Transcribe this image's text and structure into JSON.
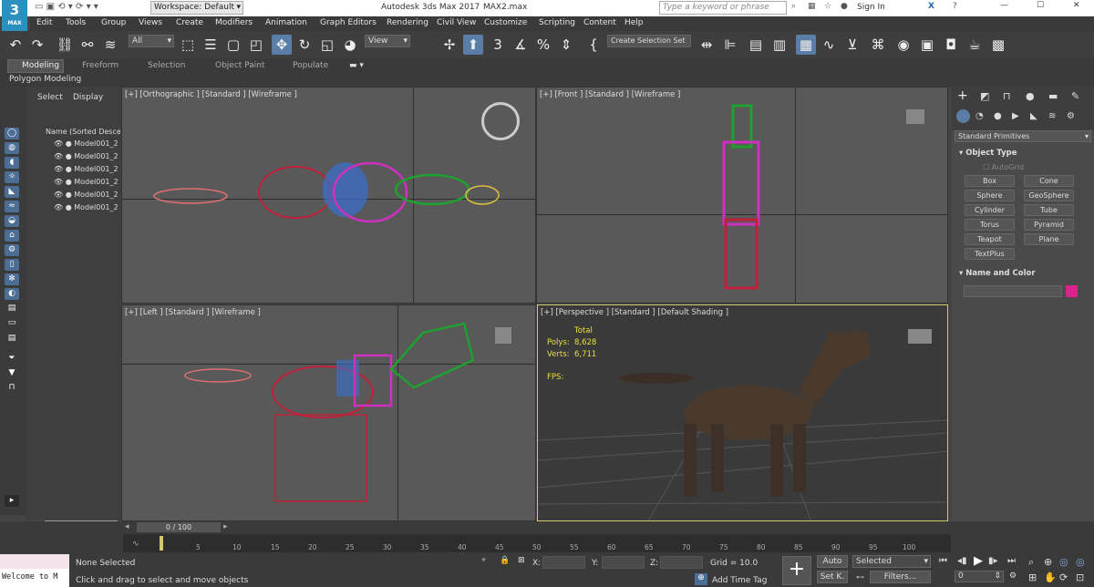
{
  "titlebar": {
    "workspace": "Workspace: Default",
    "app_title": "Autodesk 3ds Max 2017",
    "file": "MAX2.max",
    "search_placeholder": "Type a keyword or phrase",
    "sign_in": "Sign In",
    "logo_text": "3",
    "logo_sub": "MAX"
  },
  "menu": [
    "Edit",
    "Tools",
    "Group",
    "Views",
    "Create",
    "Modifiers",
    "Animation",
    "Graph Editors",
    "Rendering",
    "Civil View",
    "Customize",
    "Scripting",
    "Content",
    "Help"
  ],
  "toolbar": {
    "filter": "All",
    "ref_coord": "View",
    "selection_set": "Create Selection Set"
  },
  "ribbon": {
    "tabs": [
      "Modeling",
      "Freeform",
      "Selection",
      "Object Paint",
      "Populate"
    ],
    "sub": "Polygon Modeling"
  },
  "scene": {
    "tabs": [
      "Select",
      "Display"
    ],
    "header": "Name (Sorted Descen",
    "items": [
      "Model001_2",
      "Model001_2",
      "Model001_2",
      "Model001_2",
      "Model001_2",
      "Model001_2"
    ]
  },
  "viewports": {
    "top": "[+] [Orthographic ] [Standard ] [Wireframe ]",
    "front": "[+] [Front ] [Standard ] [Wireframe ]",
    "left": "[+] [Left ] [Standard ] [Wireframe ]",
    "persp": "[+] [Perspective ] [Standard ] [Default Shading ]"
  },
  "stats": {
    "total": "Total",
    "polys_label": "Polys:",
    "polys": "8,628",
    "verts_label": "Verts:",
    "verts": "6,711",
    "fps": "FPS:"
  },
  "cmd": {
    "dropdown": "Standard Primitives",
    "object_type": "Object Type",
    "autogrid": "AutoGrid",
    "buttons": [
      "Box",
      "Cone",
      "Sphere",
      "GeoSphere",
      "Cylinder",
      "Tube",
      "Torus",
      "Pyramid",
      "Teapot",
      "Plane",
      "TextPlus"
    ],
    "name_color": "Name and Color",
    "accent": "#d6248f"
  },
  "timeline": {
    "frame": "0 / 100",
    "ticks": [
      "5",
      "10",
      "15",
      "20",
      "25",
      "30",
      "35",
      "40",
      "45",
      "50",
      "55",
      "60",
      "65",
      "70",
      "75",
      "80",
      "85",
      "90",
      "95",
      "100"
    ]
  },
  "status": {
    "listener": "Welcome to M",
    "none_selected": "None Selected",
    "prompt": "Click and drag to select and move objects",
    "x": "X:",
    "y": "Y:",
    "z": "Z:",
    "grid": "Grid = 10.0",
    "add_tag": "Add Time Tag",
    "auto": "Auto",
    "selected": "Selected",
    "setk": "Set K.",
    "filters": "Filters...",
    "frame_field": "0"
  }
}
